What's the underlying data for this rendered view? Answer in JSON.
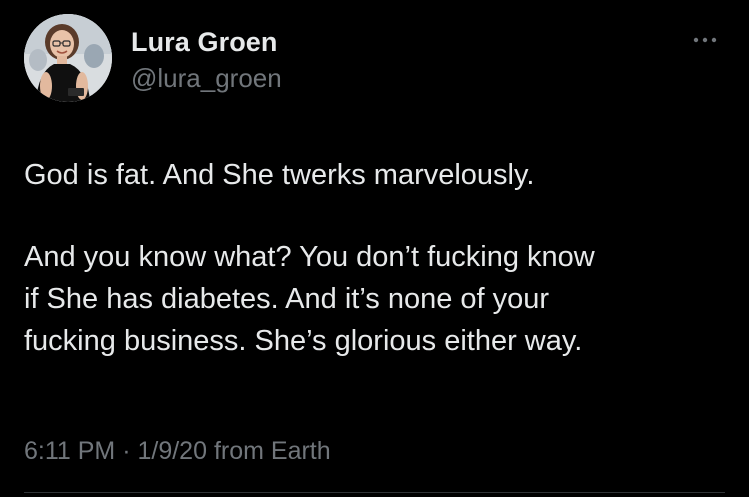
{
  "author": {
    "display_name": "Lura Groen",
    "handle": "@lura_groen"
  },
  "more_icon": "more-horizontal-icon",
  "tweet": {
    "paragraphs": [
      "God is fat.  And She twerks marvelously.",
      "And you know what? You don’t fucking know\nif She has diabetes. And it’s none of your\nfucking business. She’s glorious either way."
    ]
  },
  "meta": {
    "time": "6:11 PM",
    "separator": "·",
    "date": "1/9/20",
    "source": "from Earth"
  },
  "colors": {
    "background": "#000000",
    "primary_text": "#e7e9ea",
    "secondary_text": "#71767b",
    "divider": "#2f3336"
  }
}
